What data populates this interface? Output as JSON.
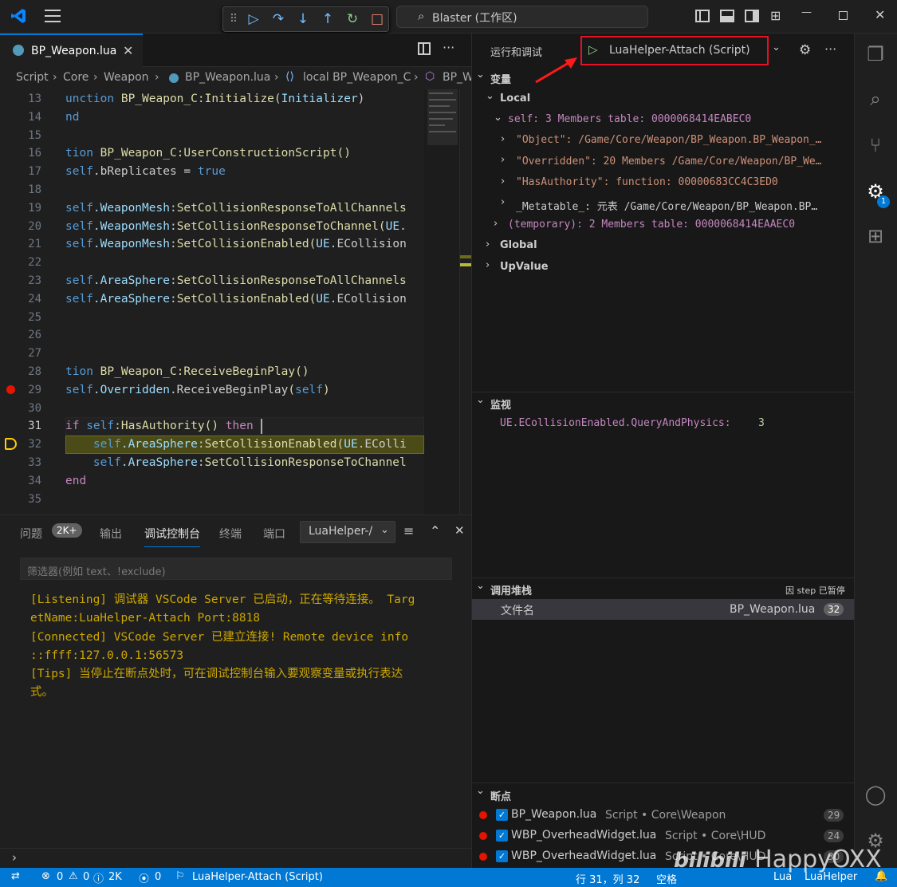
{
  "titlebar": {
    "search": "Blaster (工作区)"
  },
  "tab": {
    "label": "BP_Weapon.lua"
  },
  "breadcrumb": [
    "Script",
    "Core",
    "Weapon",
    "BP_Weapon.lua",
    "local BP_Weapon_C",
    "BP_W"
  ],
  "editor": {
    "current_line": 31,
    "breakpoint_line": 29,
    "stopped_line": 32,
    "lines": [
      {
        "n": "13",
        "segs": [
          [
            "kb",
            "unction "
          ],
          [
            "fn",
            "BP_Weapon_C:Initialize"
          ],
          [
            "",
            "("
          ],
          [
            "pr",
            "Initializer"
          ],
          [
            "",
            ")"
          ]
        ]
      },
      {
        "n": "14",
        "segs": [
          [
            "kb",
            "nd"
          ]
        ]
      },
      {
        "n": "15",
        "segs": []
      },
      {
        "n": "16",
        "segs": [
          [
            "kb",
            "tion "
          ],
          [
            "fn",
            "BP_Weapon_C:UserConstructionScript"
          ],
          [
            "yel",
            "()"
          ]
        ]
      },
      {
        "n": "17",
        "segs": [
          [
            "kb",
            "self"
          ],
          [
            "",
            ".bReplicates = "
          ],
          [
            "kb",
            "true"
          ]
        ]
      },
      {
        "n": "18",
        "segs": []
      },
      {
        "n": "19",
        "segs": [
          [
            "kb",
            "self"
          ],
          [
            "pr",
            ".WeaponMesh"
          ],
          [
            "",
            ":"
          ],
          [
            "fn",
            "SetCollisionResponseToAllChannels"
          ]
        ]
      },
      {
        "n": "20",
        "segs": [
          [
            "kb",
            "self"
          ],
          [
            "pr",
            ".WeaponMesh"
          ],
          [
            "",
            ":"
          ],
          [
            "fn",
            "SetCollisionResponseToChannel"
          ],
          [
            "yel",
            "("
          ],
          [
            "pr",
            "UE"
          ],
          [
            "",
            "."
          ]
        ]
      },
      {
        "n": "21",
        "segs": [
          [
            "kb",
            "self"
          ],
          [
            "pr",
            ".WeaponMesh"
          ],
          [
            "",
            ":"
          ],
          [
            "fn",
            "SetCollisionEnabled"
          ],
          [
            "yel",
            "("
          ],
          [
            "pr",
            "UE"
          ],
          [
            "",
            ".ECollision"
          ]
        ]
      },
      {
        "n": "22",
        "segs": []
      },
      {
        "n": "23",
        "segs": [
          [
            "kb",
            "self"
          ],
          [
            "pr",
            ".AreaSphere"
          ],
          [
            "",
            ":"
          ],
          [
            "fn",
            "SetCollisionResponseToAllChannels"
          ]
        ]
      },
      {
        "n": "24",
        "segs": [
          [
            "kb",
            "self"
          ],
          [
            "pr",
            ".AreaSphere"
          ],
          [
            "",
            ":"
          ],
          [
            "fn",
            "SetCollisionEnabled"
          ],
          [
            "yel",
            "("
          ],
          [
            "pr",
            "UE"
          ],
          [
            "",
            ".ECollision"
          ]
        ]
      },
      {
        "n": "25",
        "segs": []
      },
      {
        "n": "26",
        "segs": []
      },
      {
        "n": "27",
        "segs": []
      },
      {
        "n": "28",
        "segs": [
          [
            "kb",
            "tion "
          ],
          [
            "fn",
            "BP_Weapon_C:ReceiveBeginPlay"
          ],
          [
            "yel",
            "()"
          ]
        ]
      },
      {
        "n": "29",
        "segs": [
          [
            "kb",
            "self"
          ],
          [
            "pr",
            ".Overridden"
          ],
          [
            "",
            ".ReceiveBeginPlay"
          ],
          [
            "yel",
            "("
          ],
          [
            "kb",
            "self"
          ],
          [
            "yel",
            ")"
          ]
        ]
      },
      {
        "n": "30",
        "segs": []
      },
      {
        "n": "31",
        "segs": [
          [
            "kw",
            "if "
          ],
          [
            "kb",
            "self"
          ],
          [
            "",
            ":"
          ],
          [
            "fn",
            "HasAuthority"
          ],
          [
            "yel",
            "() "
          ],
          [
            "kw",
            "then"
          ]
        ]
      },
      {
        "n": "32",
        "segs": [
          [
            "",
            "    "
          ],
          [
            "kb",
            "self"
          ],
          [
            "pr",
            ".AreaSphere"
          ],
          [
            "",
            ":"
          ],
          [
            "fn",
            "SetCollisionEnabled"
          ],
          [
            "yel",
            "("
          ],
          [
            "pr",
            "UE"
          ],
          [
            "",
            ".EColli"
          ]
        ]
      },
      {
        "n": "33",
        "segs": [
          [
            "",
            "    "
          ],
          [
            "kb",
            "self"
          ],
          [
            "pr",
            ".AreaSphere"
          ],
          [
            "",
            ":"
          ],
          [
            "fn",
            "SetCollisionResponseToChannel"
          ]
        ]
      },
      {
        "n": "34",
        "segs": [
          [
            "kw",
            "end"
          ]
        ]
      },
      {
        "n": "35",
        "segs": []
      }
    ]
  },
  "panel": {
    "tabs": [
      "问题",
      "输出",
      "调试控制台",
      "终端",
      "端口"
    ],
    "badge": "2K+",
    "dropdown": "LuaHelper-/",
    "filter_placeholder": "筛选器(例如 text、!exclude)",
    "console": [
      "[Listening] 调试器 VSCode Server 已启动，正在等待连接。  Targ",
      "etName:LuaHelper-Attach Port:8818",
      "[Connected] VSCode Server 已建立连接! Remote device info",
      "::ffff:127.0.0.1:56573",
      "[Tips] 当停止在断点处时，可在调试控制台输入要观察变量或执行表达",
      "式。"
    ]
  },
  "debug": {
    "title": "运行和调试",
    "config": "LuaHelper-Attach (Script)"
  },
  "variables": {
    "title": "变量",
    "local": "Local",
    "self": "self: 3 Members table: 0000068414EABEC0",
    "items": [
      "\"Object\": /Game/Core/Weapon/BP_Weapon.BP_Weapon_…",
      "\"Overridden\": 20 Members /Game/Core/Weapon/BP_We…",
      "\"HasAuthority\": function: 00000683CC4C3ED0",
      "_Metatable_: 元表 /Game/Core/Weapon/BP_Weapon.BP…"
    ],
    "temporary": "(temporary): 2 Members table: 0000068414EAAEC0",
    "global": "Global",
    "upvalue": "UpValue"
  },
  "watch": {
    "title": "监视",
    "expr": "UE.ECollisionEnabled.QueryAndPhysics:",
    "value": "3"
  },
  "callstack": {
    "title": "调用堆栈",
    "status": "因 step 已暂停",
    "col": "文件名",
    "file": "BP_Weapon.lua",
    "line": "32"
  },
  "breakpoints": {
    "title": "断点",
    "items": [
      {
        "file": "BP_Weapon.lua",
        "path": "Script • Core\\Weapon",
        "line": "29"
      },
      {
        "file": "WBP_OverheadWidget.lua",
        "path": "Script • Core\\HUD",
        "line": "24"
      },
      {
        "file": "WBP_OverheadWidget.lua",
        "path": "Script • Core\\HUD",
        "line": "30"
      }
    ]
  },
  "statusbar": {
    "errors": "0",
    "warnings": "0",
    "info": "2K",
    "ports": "0",
    "debug": "LuaHelper-Attach (Script)",
    "position": "行 31，列 32",
    "spaces": "空格",
    "lang": "Lua",
    "ext": "LuaHelper"
  },
  "watermark": "HappyOXX",
  "colors": {
    "accent": "#0078d4",
    "breakpoint": "#e51400",
    "highlight": "#ff0000"
  }
}
